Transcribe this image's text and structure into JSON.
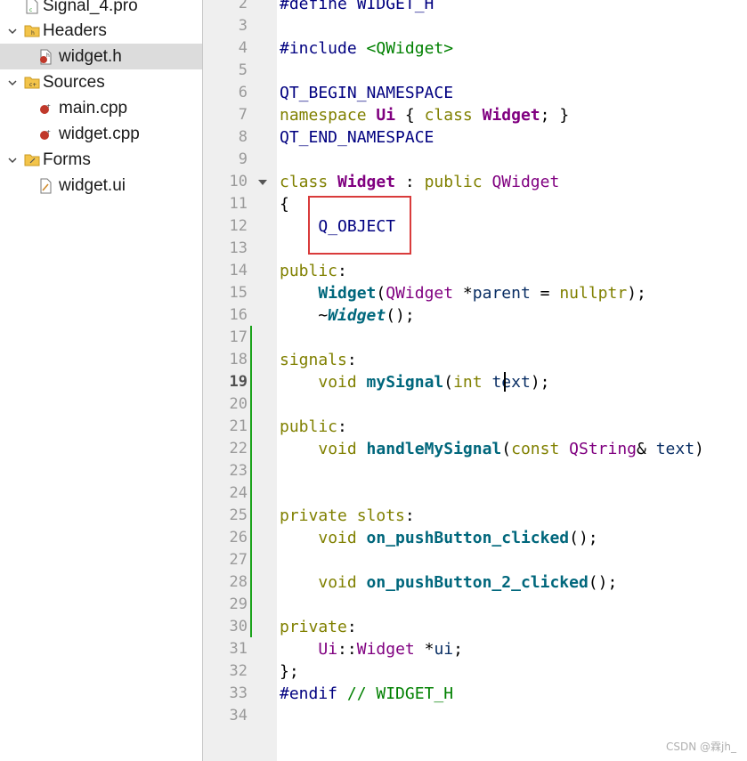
{
  "project_tree": {
    "items": [
      {
        "label": "Signal_4.pro",
        "icon": "pro-file-icon"
      },
      {
        "label": "Headers",
        "icon": "folder-headers-icon",
        "expanded": true
      },
      {
        "label": "widget.h",
        "icon": "header-file-icon",
        "selected": true
      },
      {
        "label": "Sources",
        "icon": "folder-sources-icon",
        "expanded": true
      },
      {
        "label": "main.cpp",
        "icon": "cpp-file-icon"
      },
      {
        "label": "widget.cpp",
        "icon": "cpp-file-icon"
      },
      {
        "label": "Forms",
        "icon": "folder-forms-icon",
        "expanded": true
      },
      {
        "label": "widget.ui",
        "icon": "ui-file-icon"
      }
    ]
  },
  "editor": {
    "current_line": "19",
    "line_numbers": [
      "2",
      "3",
      "4",
      "5",
      "6",
      "7",
      "8",
      "9",
      "10",
      "11",
      "12",
      "13",
      "14",
      "15",
      "16",
      "17",
      "18",
      "19",
      "20",
      "21",
      "22",
      "23",
      "24",
      "25",
      "26",
      "27",
      "28",
      "29",
      "30",
      "31",
      "32",
      "33",
      "34"
    ],
    "lines": {
      "l2": {
        "a": "#define WIDGET_H"
      },
      "l4": {
        "a": "#include ",
        "b": "<QWidget>"
      },
      "l6": {
        "a": "QT_BEGIN_NAMESPACE"
      },
      "l7": {
        "a": "namespace ",
        "b": "Ui",
        "c": " { ",
        "d": "class ",
        "e": "Widget",
        "f": "; }"
      },
      "l8": {
        "a": "QT_END_NAMESPACE"
      },
      "l10": {
        "a": "class ",
        "b": "Widget",
        "c": " : ",
        "d": "public ",
        "e": "QWidget"
      },
      "l11": {
        "a": "{"
      },
      "l12": {
        "a": "    ",
        "b": "Q_OBJECT"
      },
      "l14": {
        "a": "public",
        "b": ":"
      },
      "l15": {
        "a": "    ",
        "b": "Widget",
        "c": "(",
        "d": "QWidget",
        "e": " *",
        "f": "parent",
        "g": " = ",
        "h": "nullptr",
        "i": ");"
      },
      "l16": {
        "a": "    ~",
        "b": "Widget",
        "c": "();"
      },
      "l18": {
        "a": "signals",
        "b": ":"
      },
      "l19": {
        "a": "    ",
        "b": "void ",
        "c": "mySignal",
        "d": "(",
        "e": "int",
        "f": " ",
        "g": "text",
        "h": ");"
      },
      "l21": {
        "a": "public",
        "b": ":"
      },
      "l22": {
        "a": "    ",
        "b": "void ",
        "c": "handleMySignal",
        "d": "(",
        "e": "const ",
        "f": "QString",
        "g": "& ",
        "h": "text",
        "i": ")"
      },
      "l25": {
        "a": "private slots",
        "b": ":"
      },
      "l26": {
        "a": "    ",
        "b": "void ",
        "c": "on_pushButton_clicked",
        "d": "();"
      },
      "l28": {
        "a": "    ",
        "b": "void ",
        "c": "on_pushButton_2_clicked",
        "d": "();"
      },
      "l30": {
        "a": "private",
        "b": ":"
      },
      "l31": {
        "a": "    ",
        "b": "Ui",
        "c": "::",
        "d": "Widget",
        "e": " *",
        "f": "ui",
        "g": ";"
      },
      "l32": {
        "a": "};"
      },
      "l33": {
        "a": "#endif ",
        "b": "// WIDGET_H"
      }
    }
  },
  "watermark": "CSDN @霖jh_",
  "colors": {
    "keyword": "#808000",
    "macro": "#000080",
    "type": "#800080",
    "string": "#008000",
    "function": "#00677c",
    "highlight_box": "#d93b3b",
    "change_bar": "#1aa31a",
    "selection": "#dcdcdc"
  }
}
